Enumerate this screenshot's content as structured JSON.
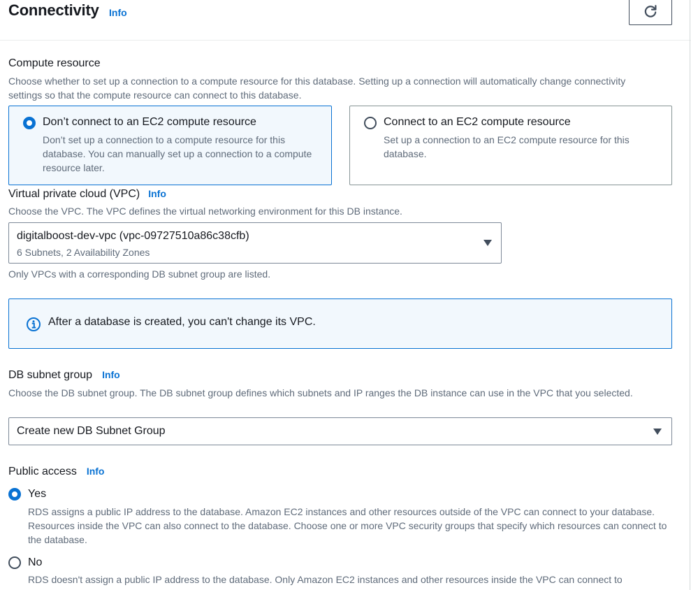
{
  "header": {
    "title": "Connectivity",
    "info": "Info"
  },
  "compute": {
    "label": "Compute resource",
    "description": "Choose whether to set up a connection to a compute resource for this database. Setting up a connection will automatically change connectivity settings so that the compute resource can connect to this database.",
    "options": [
      {
        "title": "Don’t connect to an EC2 compute resource",
        "description": "Don’t set up a connection to a compute resource for this database. You can manually set up a connection to a compute resource later.",
        "selected": true
      },
      {
        "title": "Connect to an EC2 compute resource",
        "description": "Set up a connection to an EC2 compute resource for this database.",
        "selected": false
      }
    ]
  },
  "vpc": {
    "label": "Virtual private cloud (VPC)",
    "info": "Info",
    "description": "Choose the VPC. The VPC defines the virtual networking environment for this DB instance.",
    "selected": "digitalboost-dev-vpc (vpc-09727510a86c38cfb)",
    "selected_detail": "6 Subnets, 2 Availability Zones",
    "constraint": "Only VPCs with a corresponding DB subnet group are listed."
  },
  "alert": {
    "text": "After a database is created, you can't change its VPC."
  },
  "subnet": {
    "label": "DB subnet group",
    "info": "Info",
    "description": "Choose the DB subnet group. The DB subnet group defines which subnets and IP ranges the DB instance can use in the VPC that you selected.",
    "selected": "Create new DB Subnet Group"
  },
  "public_access": {
    "label": "Public access",
    "info": "Info",
    "options": [
      {
        "label": "Yes",
        "description": "RDS assigns a public IP address to the database. Amazon EC2 instances and other resources outside of the VPC can connect to your database. Resources inside the VPC can also connect to the database. Choose one or more VPC security groups that specify which resources can connect to the database.",
        "selected": true
      },
      {
        "label": "No",
        "description": "RDS doesn't assign a public IP address to the database. Only Amazon EC2 instances and other resources inside the VPC can connect to",
        "selected": false
      }
    ]
  },
  "colors": {
    "accent": "#0972d3",
    "text": "#16191f",
    "secondary_text": "#5f6b7a",
    "selected_tile_bg": "#f2f8fd"
  },
  "icons": [
    "refresh-icon",
    "info-circle-icon",
    "caret-down-icon"
  ]
}
